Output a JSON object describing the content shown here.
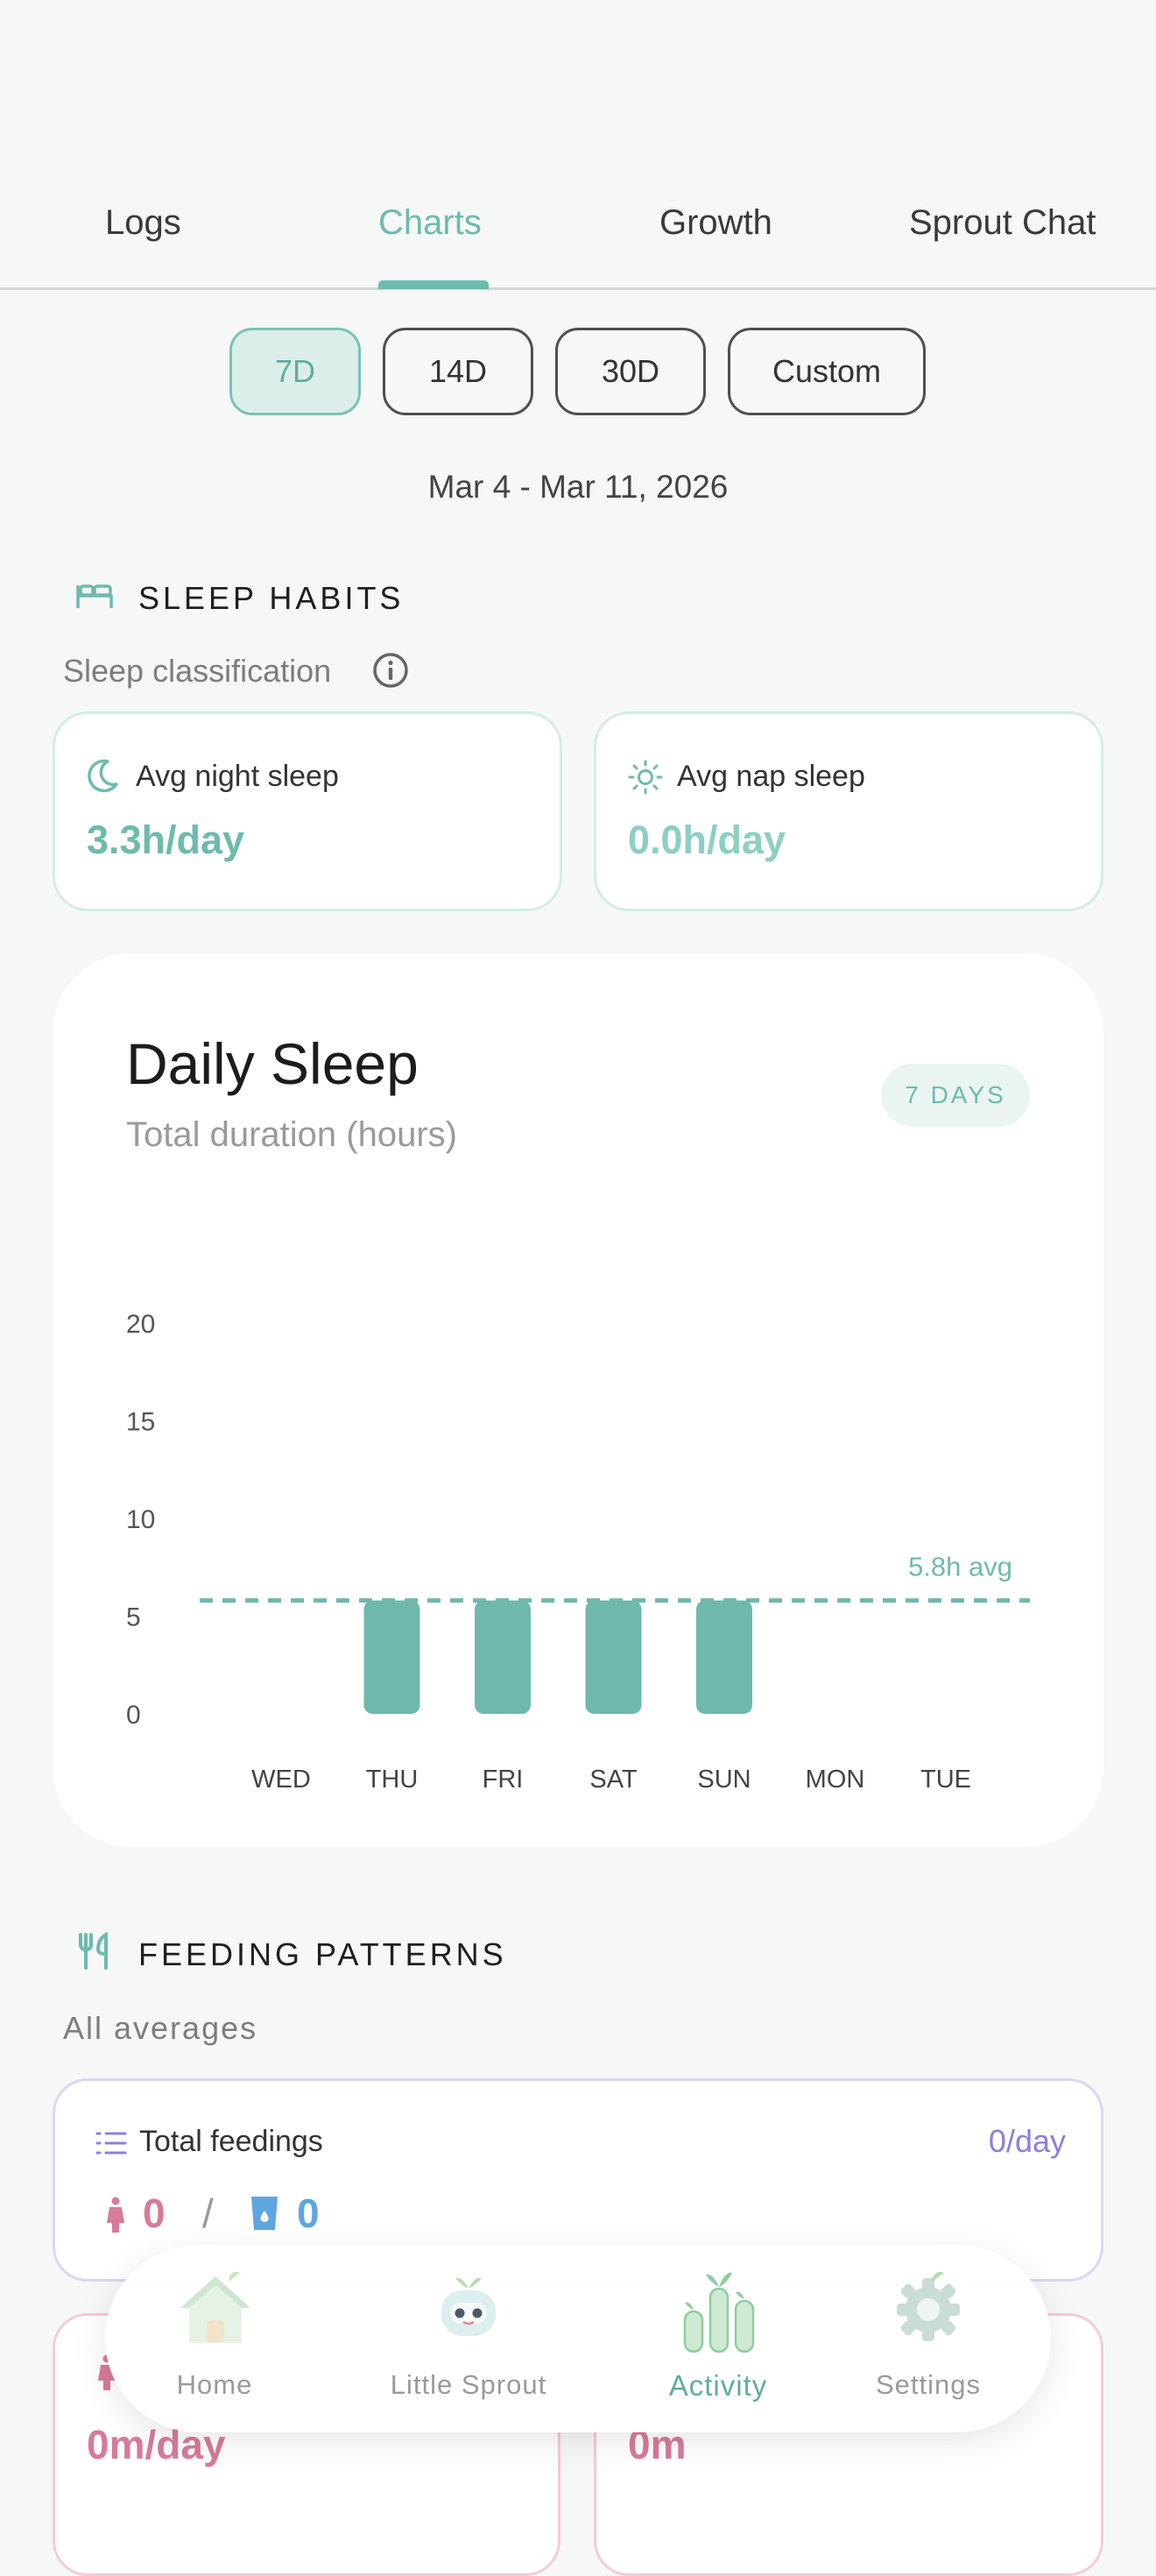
{
  "tabs": [
    {
      "label": "Logs"
    },
    {
      "label": "Charts",
      "active": true
    },
    {
      "label": "Growth"
    },
    {
      "label": "Sprout Chat"
    }
  ],
  "range_pills": [
    {
      "label": "7D",
      "active": true
    },
    {
      "label": "14D"
    },
    {
      "label": "30D"
    },
    {
      "label": "Custom"
    }
  ],
  "date_range": "Mar 4 - Mar 11, 2026",
  "sleep": {
    "section_title": "SLEEP HABITS",
    "section_icon": "bed-icon",
    "classification_label": "Sleep classification",
    "info_icon": "info-icon",
    "night": {
      "label": "Avg night sleep",
      "value": "3.3h/day",
      "icon": "moon-icon"
    },
    "nap": {
      "label": "Avg nap sleep",
      "value": "0.0h/day",
      "icon": "sun-icon"
    }
  },
  "chart": {
    "title": "Daily Sleep",
    "subtitle": "Total duration (hours)",
    "badge": "7 DAYS",
    "avg_label": "5.8h avg"
  },
  "chart_data": {
    "type": "bar",
    "title": "Daily Sleep",
    "subtitle": "Total duration (hours)",
    "categories": [
      "WED",
      "THU",
      "FRI",
      "SAT",
      "SUN",
      "MON",
      "TUE"
    ],
    "values": [
      0,
      5.8,
      5.8,
      5.8,
      5.8,
      0,
      0
    ],
    "y_ticks": [
      0,
      5,
      10,
      15,
      20
    ],
    "ylim": [
      0,
      20
    ],
    "average": 5.8,
    "average_label": "5.8h avg",
    "bar_color": "#6fb8ac",
    "grid": false
  },
  "feeding": {
    "section_title": "FEEDING PATTERNS",
    "section_icon": "fork-knife-icon",
    "subtitle": "All averages",
    "total_card": {
      "label": "Total feedings",
      "rate": "0/day",
      "breast_value": "0",
      "separator": "/",
      "bottle_value": "0",
      "icon": "list-icon"
    },
    "left_card_value": "0m/day",
    "right_card_value": "0m"
  },
  "bottom_nav": [
    {
      "label": "Home",
      "icon": "house-icon"
    },
    {
      "label": "Little Sprout",
      "icon": "robot-sprout-icon"
    },
    {
      "label": "Activity",
      "icon": "activity-bars-icon",
      "active": true
    },
    {
      "label": "Settings",
      "icon": "gear-icon"
    }
  ],
  "colors": {
    "accent": "#6dbbad",
    "purple": "#8c7ee0",
    "pink": "#d87a9a",
    "blue": "#5ea6e0"
  }
}
